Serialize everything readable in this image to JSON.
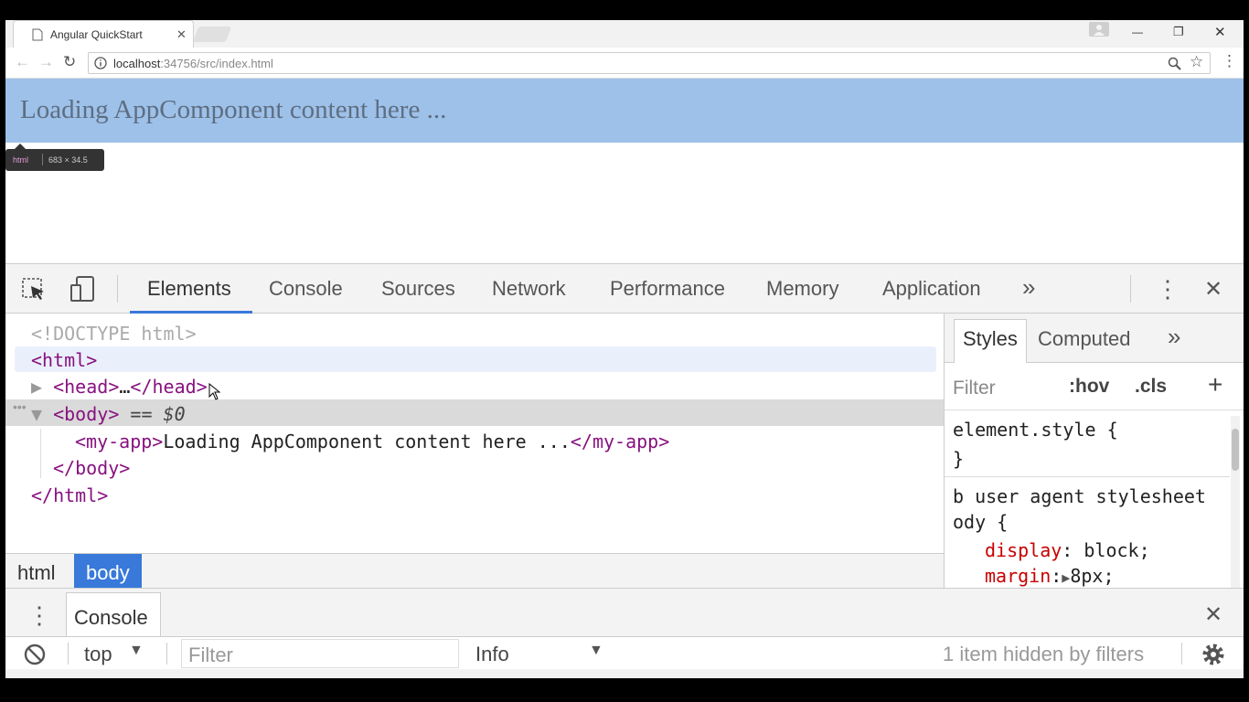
{
  "browser": {
    "tab_title": "Angular QuickStart",
    "tab_close": "✕",
    "url_host": "localhost",
    "url_rest": ":34756/src/index.html",
    "window_controls": {
      "minimize": "—",
      "restore": "❐",
      "close": "✕"
    }
  },
  "page": {
    "loading_text": "Loading AppComponent content here ...",
    "tooltip_tag": "html",
    "tooltip_dims": "683 × 34.5"
  },
  "devtools": {
    "tabs": [
      "Elements",
      "Console",
      "Sources",
      "Network",
      "Performance",
      "Memory",
      "Application"
    ],
    "more_tabs": "»",
    "dom": {
      "doctype": "<!DOCTYPE html>",
      "html_open": "<html>",
      "head_tag": "head",
      "head_ellipsis": "…",
      "body_tag": "body",
      "body_suffix": " == $0",
      "myapp_tag": "my-app",
      "myapp_text": "Loading AppComponent content here ...",
      "body_close": "</body>",
      "html_close": "</html>"
    },
    "breadcrumbs": [
      "html",
      "body"
    ],
    "styles": {
      "tabs": [
        "Styles",
        "Computed"
      ],
      "more": "»",
      "filter_placeholder": "Filter",
      "hov": ":hov",
      "cls": ".cls",
      "add": "+",
      "element_style_open": "element.style {",
      "element_style_close": "}",
      "ua_line1": "b user agent stylesheet",
      "ua_line2": "ody {",
      "prop1_name": "display",
      "prop1_value": "block;",
      "prop2_name": "margin",
      "prop2_value": "8px;"
    },
    "drawer": {
      "tab": "Console",
      "context": "top",
      "filter_placeholder": "Filter",
      "level": "Info",
      "hidden_msg": "1 item hidden by filters"
    }
  }
}
